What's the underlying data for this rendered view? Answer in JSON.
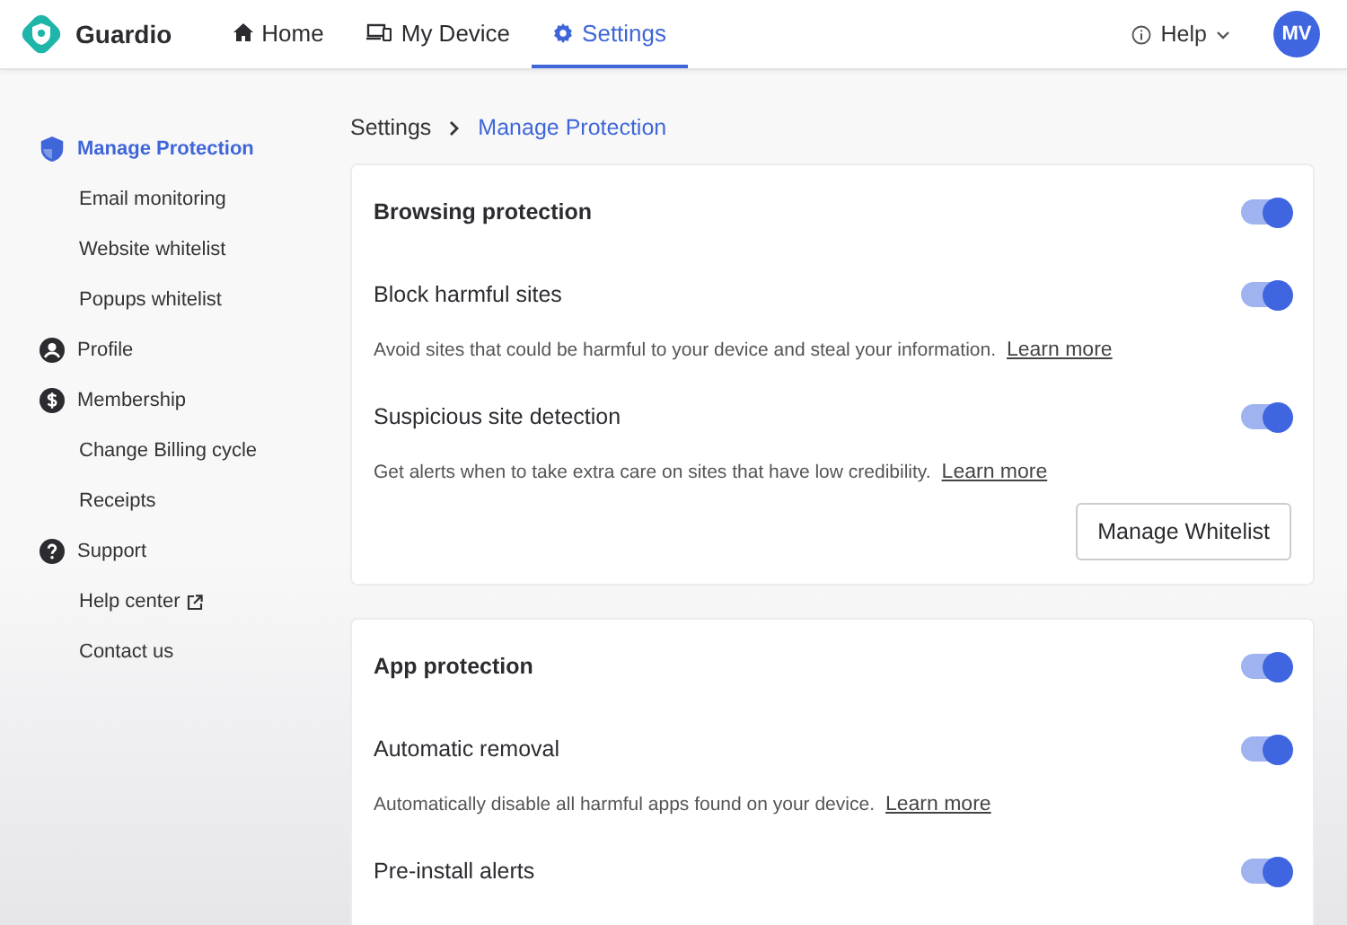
{
  "brand": "Guardio",
  "nav": [
    {
      "label": "Home",
      "selected": false
    },
    {
      "label": "My Device",
      "selected": false
    },
    {
      "label": "Settings",
      "selected": true
    }
  ],
  "help": "Help",
  "avatar": "MV",
  "sidebar": {
    "items": [
      {
        "label": "Manage Protection",
        "selected": true,
        "children": [
          {
            "label": "Email monitoring",
            "selected": false,
            "external": false
          },
          {
            "label": "Website whitelist",
            "selected": false,
            "external": false
          },
          {
            "label": "Popups whitelist",
            "selected": false,
            "external": false
          }
        ]
      },
      {
        "label": "Profile",
        "selected": false
      },
      {
        "label": "Membership",
        "selected": false,
        "children": [
          {
            "label": "Change Billing cycle",
            "selected": false,
            "external": false
          },
          {
            "label": "Receipts",
            "selected": false,
            "external": false
          }
        ]
      },
      {
        "label": "Support",
        "selected": false,
        "children": [
          {
            "label": "Help center",
            "selected": false,
            "external": true
          },
          {
            "label": "Contact us",
            "selected": false,
            "external": false
          }
        ]
      }
    ]
  },
  "breadcrumb": [
    "Settings",
    "Manage Protection"
  ],
  "cards": [
    {
      "title": "Browsing protection",
      "on": true,
      "rows": [
        {
          "label": "Block harmful sites",
          "on": true,
          "description": "Avoid sites that could be harmful to your device and steal your information.",
          "link": "Learn more"
        },
        {
          "label": "Suspicious site detection",
          "on": true,
          "description": "Get alerts when to take extra care on sites that have low credibility.",
          "link": "Learn more"
        }
      ],
      "button": "Manage Whitelist"
    },
    {
      "title": "App protection",
      "on": true,
      "rows": [
        {
          "label": "Automatic removal",
          "on": true,
          "description": "Automatically disable all harmful apps found on your device.",
          "link": "Learn more"
        },
        {
          "label": "Pre-install alerts",
          "on": true
        }
      ]
    }
  ]
}
